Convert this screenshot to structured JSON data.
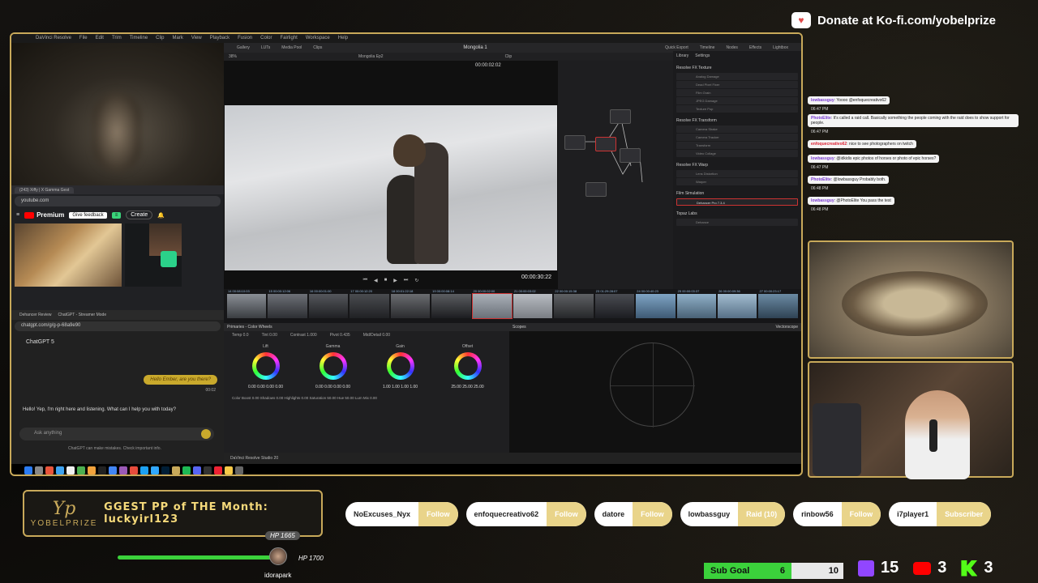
{
  "donate": {
    "text": "Donate at Ko-fi.com/yobelprize"
  },
  "resolve": {
    "menu": [
      "DaVinci Resolve",
      "File",
      "Edit",
      "Trim",
      "Timeline",
      "Clip",
      "Mark",
      "View",
      "Playback",
      "Fusion",
      "Color",
      "Fairlight",
      "Workspace",
      "Help"
    ],
    "project_title": "Mongolia 1",
    "timeline_name": "Mongolia Ep2",
    "tabs": [
      "Gallery",
      "LUTs",
      "Media Pool",
      "Clips"
    ],
    "right_tabs": [
      "Quick Export",
      "Timeline",
      "Nodes",
      "Effects",
      "Lightbox"
    ],
    "zoom": "38%",
    "timecode_top": "00:00:02:02",
    "timecode": "00:00:30:22",
    "clip_label": "Clip",
    "library_tabs": [
      "Library",
      "Settings"
    ],
    "library": [
      {
        "section": "Resolve FX Texture",
        "items": [
          "Analog Damage",
          "Dead Pixel Fixer",
          "Film Grain",
          "JPEG Damage",
          "Texture Pop"
        ]
      },
      {
        "section": "Resolve FX Transform",
        "items": [
          "Camera Shake",
          "Camera Tracker",
          "Transform",
          "Video Collage"
        ]
      },
      {
        "section": "Resolve FX Warp",
        "items": [
          "Lens Distortion",
          "Warper"
        ]
      },
      {
        "section": "Film Simulation",
        "items": [
          "Dehancer Pro 7.3.4"
        ]
      },
      {
        "section": "Topaz Labs",
        "items": [
          "Dehance"
        ]
      }
    ],
    "clips": [
      "14 00:08:10:03",
      "15 00:00:12:06",
      "16 00:00:01:00",
      "17 00:00:12:20",
      "18 00:01:22:18",
      "19 00:00:08:14",
      "20 00:00:02:00",
      "21 00:00:03:02",
      "22 00:00:15:38",
      "23 01:29:28:07",
      "24 00:00:40:23",
      "25 00:00:03:37",
      "26 00:00:09:36",
      "27 00:00:23:17"
    ],
    "color_panel": {
      "title": "Primaries - Color Wheels",
      "temp": "Temp 0.0",
      "tint": "Tint 0.00",
      "contrast": "Contrast 1.000",
      "pivot": "Pivot 0.435",
      "mid": "Mid/Detail 0.00",
      "wheels": [
        {
          "label": "Lift",
          "values": "0.00  0.00  0.00  0.00"
        },
        {
          "label": "Gamma",
          "values": "0.00  0.00  0.00  0.00"
        },
        {
          "label": "Gain",
          "values": "1.00  1.00  1.00  1.00"
        },
        {
          "label": "Offset",
          "values": "25.00  25.00  25.00"
        }
      ],
      "bottom": "Color Boost 0.00   Shadows 0.00   Highlights 0.00   Saturation 50.00   Hue 50.00   Lum Mix 0.00"
    },
    "scopes_title": "Scopes",
    "scope_type": "Vectorscope",
    "footer": "DaVinci Resolve Studio 20"
  },
  "browser": {
    "yt_tab": "(243) Xiffy | X Gamma Gest",
    "yt_url": "youtube.com",
    "yt_logo": "Premium",
    "give_feedback": "Give feedback",
    "create": "Create",
    "chat_tabs": [
      "Dehancer Review",
      "ChatGPT - Streamer Mode"
    ],
    "chat_url": "chatgpt.com/g/g-p-68a9e90",
    "chat_model": "ChatGPT 5",
    "user_msg": "Hello Ember, are you there?",
    "user_time": "00:02",
    "assistant_msg": "Hello! Yep, I'm right here and listening. What can I help you with today?",
    "input_placeholder": "Ask anything",
    "disclaimer": "ChatGPT can make mistakes. Check important info."
  },
  "twitch_chat": [
    {
      "user": "lowbassguy",
      "text": ": Yoooo @enfoquecreativo62",
      "time": "06:47 PM"
    },
    {
      "user": "PhotoElite",
      "text": ": It's called a raid call. Basically something the people coming with the raid does to show support for people.",
      "time": "06:47 PM"
    },
    {
      "user": "enfoquecreativo62",
      "text": ": nice to see photographers on twitch",
      "time": ""
    },
    {
      "user": "lowbassguy",
      "text": ": @idkidis epic photos of horses or photo of epic horses?",
      "time": "06:47 PM"
    },
    {
      "user": "PhotoElite",
      "text": ": @lowbassguy Probably both.",
      "time": "06:48 PM"
    },
    {
      "user": "lowbassguy",
      "text": ": @PhotoElite You pass the test",
      "time": "06:48 PM"
    }
  ],
  "banner": {
    "logo_mark": "Yp",
    "logo_name": "YOBELPRIZE",
    "ticker": "GGEST PP of THE Month: luckyirl123"
  },
  "player": {
    "hp_top": "HP 1665",
    "hp_side": "HP 1700",
    "name": "idorapark",
    "hp_fraction": 1.0
  },
  "events": [
    {
      "name": "NoExcuses_Nyx",
      "kind": "Follow"
    },
    {
      "name": "enfoquecreativo62",
      "kind": "Follow"
    },
    {
      "name": "datore",
      "kind": "Follow"
    },
    {
      "name": "lowbassguy",
      "kind": "Raid (10)"
    },
    {
      "name": "rinbow56",
      "kind": "Follow"
    },
    {
      "name": "i7player1",
      "kind": "Subscriber"
    }
  ],
  "subgoal": {
    "label": "Sub Goal",
    "current": "6",
    "target": "10"
  },
  "counters": {
    "twitch": "15",
    "youtube": "3",
    "kick": "3"
  },
  "colors": {
    "accent_gold": "#c8a95a",
    "hp_green": "#3bd13b",
    "twitch": "#9146ff",
    "youtube": "#ff0000",
    "kick": "#53fc18"
  }
}
